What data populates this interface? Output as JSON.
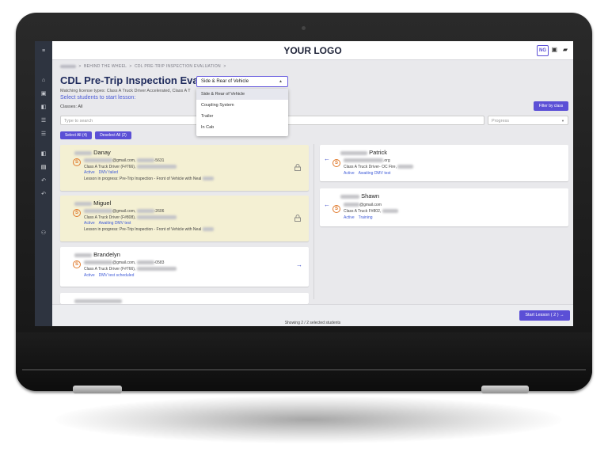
{
  "app": {
    "logo": "YOUR LOGO",
    "user_initials": "NG"
  },
  "breadcrumb": {
    "items": [
      "BEHIND THE WHEEL",
      "CDL PRE-TRIP INSPECTION EVALUATION"
    ],
    "separator": ">"
  },
  "page": {
    "title": "CDL Pre-Trip Inspection Evaluation",
    "matching": "Matching license types: Class A Truck Driver Accelerated, Class A T",
    "select_prompt": "Select students to start lesson:",
    "classes": "Classes: All"
  },
  "lesson_select": {
    "value": "Side & Rear of Vehicle",
    "options": [
      "Side & Rear of Vehicle",
      "Coupling System",
      "Trailer",
      "In Cab"
    ]
  },
  "toolbar": {
    "filter_label": "Filter by class",
    "search_placeholder": "Type to search",
    "progress_placeholder": "Progress",
    "select_all": "Select All (4)",
    "deselect_all": "Deselect All (2)"
  },
  "available_students": [
    {
      "name": "Danay",
      "email_suffix": "@gmail.com,",
      "phone_suffix": "-5631",
      "class": "Class A Truck Driver (F#766),",
      "statuses": [
        "Active",
        "DMV failed"
      ],
      "lesson_progress": "Lesson in progress: Pre-Trip Inspection - Front of Vehicle with Neal"
    },
    {
      "name": "Miguel",
      "email_suffix": "@gmail.com,",
      "phone_suffix": "-2606",
      "class": "Class A Truck Driver (F#808),",
      "statuses": [
        "Active",
        "Awaiting DMV test"
      ],
      "lesson_progress": "Lesson in progress: Pre-Trip Inspection - Front of Vehicle with Neal"
    },
    {
      "name": "Brandelyn",
      "email_suffix": "@gmail.com,",
      "phone_suffix": "-0583",
      "class": "Class A Truck Driver (F#766),",
      "statuses": [
        "Active",
        "DMV test scheduled"
      ]
    }
  ],
  "selected_students": [
    {
      "name": "Patrick",
      "email_suffix": ".org",
      "class": "Class A Truck Driver- OC Fire,",
      "statuses": [
        "Active",
        "Awaiting DMV test"
      ]
    },
    {
      "name": "Shawn",
      "email_suffix": "@gmail.com",
      "class": "Class A Truck F#802,",
      "statuses": [
        "Active",
        "Training"
      ]
    }
  ],
  "badge_letter": "S",
  "footer": {
    "showing": "Showing 2 / 2 selected students",
    "start_label": "Start Lesson ( 2 ) →"
  },
  "icons": {
    "rail": [
      "home-icon",
      "clipboard-icon",
      "copy-icon",
      "list-icon",
      "filter-icon",
      "document-icon",
      "book-icon",
      "undo-icon",
      "redo-icon",
      "people-icon"
    ],
    "lock": "lock-icon",
    "arrow_left": "arrow-left-icon",
    "arrow_right": "arrow-right-icon"
  },
  "colors": {
    "accent": "#5b4fd6",
    "locked_card": "#f4f0d3",
    "badge": "#e07a2c",
    "link": "#3f5bd8"
  }
}
